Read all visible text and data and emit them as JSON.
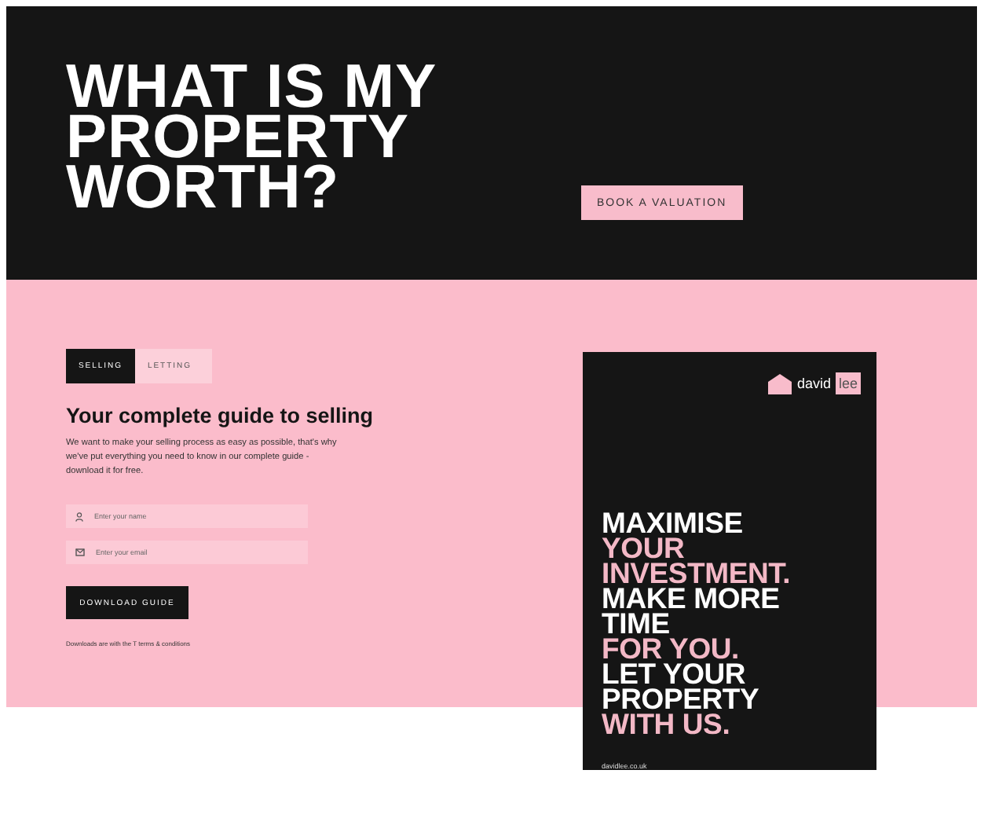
{
  "hero": {
    "title_lines": [
      "WHAT IS MY",
      "PROPERTY",
      "WORTH?"
    ],
    "button": "BOOK A VALUATION"
  },
  "tabs": [
    {
      "label": "SELLING",
      "selected": true
    },
    {
      "label": "LETTING",
      "selected": false
    }
  ],
  "guide": {
    "heading": "Your complete guide to selling",
    "body": "We want to make your selling process as easy as possible, that's why we've put everything you need to know in our complete guide - download it for free.",
    "fields": [
      {
        "kind": "name",
        "placeholder": "Enter your name"
      },
      {
        "kind": "email",
        "placeholder": "Enter your email"
      }
    ],
    "button": "DOWNLOAD GUIDE",
    "disclaimer": "Downloads are with the T ",
    "disclaimer_link": "terms & conditions"
  },
  "brochure": {
    "logo_left": "david",
    "logo_right": "lee",
    "lines": [
      {
        "text": "MAXIMISE",
        "accent": false
      },
      {
        "text": "YOUR",
        "accent": true
      },
      {
        "text": "INVESTMENT.",
        "accent": true
      },
      {
        "text": "MAKE MORE",
        "accent": false
      },
      {
        "text": "TIME",
        "accent": false
      },
      {
        "text": "FOR YOU.",
        "accent": true
      },
      {
        "text": "LET YOUR",
        "accent": false
      },
      {
        "text": "PROPERTY",
        "accent": false
      },
      {
        "text": "WITH US.",
        "accent": true
      }
    ],
    "url": "davidlee.co.uk"
  }
}
